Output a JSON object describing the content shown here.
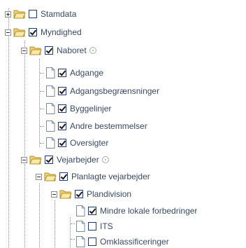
{
  "tree": {
    "stamdata": "Stamdata",
    "myndighed": "Myndighed",
    "naboret": "Naboret",
    "adgange": "Adgange",
    "adgangsbegraensninger": "Adgangsbegrænsninger",
    "byggelinjer": "Byggelinjer",
    "andre_bestemmelser": "Andre bestemmelser",
    "oversigter": "Oversigter",
    "vejarbejder": "Vejarbejder",
    "planlagte_vejarbejder": "Planlagte vejarbejder",
    "plandivision": "Plandivision",
    "mindre_lokale": "Mindre lokale forbedringer",
    "its": "ITS",
    "omklassificeringer": "Omklassificeringer"
  },
  "icons": {
    "folder": "folder-open-icon",
    "document": "document-icon",
    "info": "info-icon"
  },
  "colors": {
    "text": "#3a4a63",
    "folder": "#f3d46a",
    "checkbox_border": "#1d3a7a"
  }
}
